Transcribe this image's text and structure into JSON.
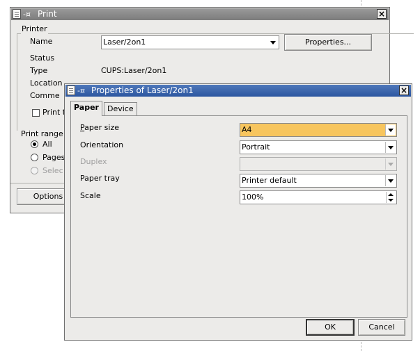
{
  "print_dialog": {
    "title": "Print",
    "printer_group": "Printer",
    "name_label": "Name",
    "name_value": "Laser/2on1",
    "properties_button": "Properties...",
    "status_label": "Status",
    "type_label": "Type",
    "type_value": "CUPS:Laser/2on1",
    "location_label": "Location",
    "comment_label": "Comme",
    "print_to_file_label": "Print t",
    "print_range_label": "Print range",
    "range_all": "All",
    "range_pages": "Pages",
    "range_selection": "Selec",
    "options_button": "Options"
  },
  "properties_dialog": {
    "title": "Properties of Laser/2on1",
    "tabs": [
      "Paper",
      "Device"
    ],
    "selected_tab": "Paper",
    "paper_size_label": "Paper size",
    "paper_size_value": "A4",
    "orientation_label": "Orientation",
    "orientation_value": "Portrait",
    "duplex_label": "Duplex",
    "duplex_value": "",
    "paper_tray_label": "Paper tray",
    "paper_tray_value": "Printer default",
    "scale_label": "Scale",
    "scale_value": "100%",
    "ok_button": "OK",
    "cancel_button": "Cancel"
  },
  "colors": {
    "titlebar_active": "#2c56a0",
    "titlebar_inactive": "#7c7c7c",
    "window_bg": "#ecebe9",
    "highlight_field": "#f7c55e"
  }
}
